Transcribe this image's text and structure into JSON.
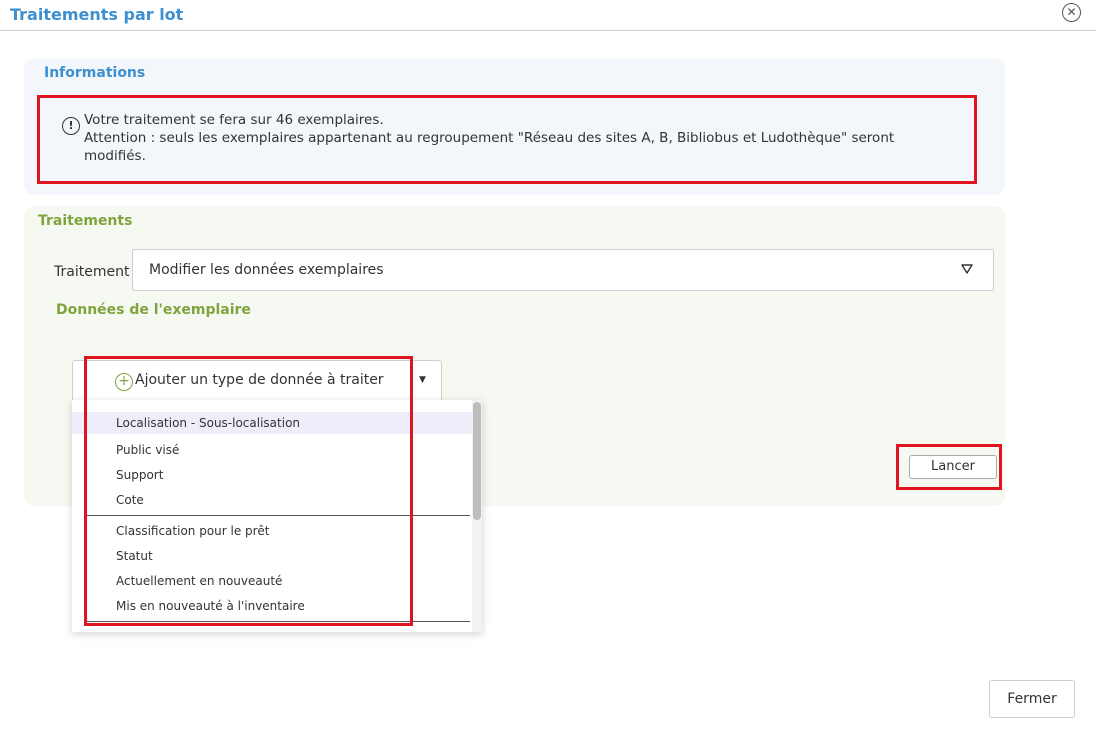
{
  "dialog": {
    "title": "Traitements par lot"
  },
  "info": {
    "heading": "Informations",
    "lines": [
      "Votre traitement se fera sur 46 exemplaires.",
      "Attention : seuls les exemplaires appartenant au regroupement \"Réseau des sites A, B, Bibliobus et Ludothèque\" seront",
      "modifiés."
    ]
  },
  "treatments": {
    "heading": "Traitements",
    "label": "Traitement",
    "selected": "Modifier les données exemplaires"
  },
  "item_data": {
    "heading": "Données de l'exemplaire",
    "add_button_label": "Ajouter un type de donnée à traiter"
  },
  "dropdown": {
    "items": [
      "Localisation - Sous-localisation",
      "Public visé",
      "Support",
      "Cote",
      "Classification pour le prêt",
      "Statut",
      "Actuellement en nouveauté",
      "Mis en nouveauté à l'inventaire"
    ],
    "active_index": 0
  },
  "buttons": {
    "launch": "Lancer",
    "close": "Fermer"
  },
  "colors": {
    "accent_blue": "#3d8fd0",
    "accent_green": "#7fa43e",
    "highlight_red": "#e0141e"
  }
}
